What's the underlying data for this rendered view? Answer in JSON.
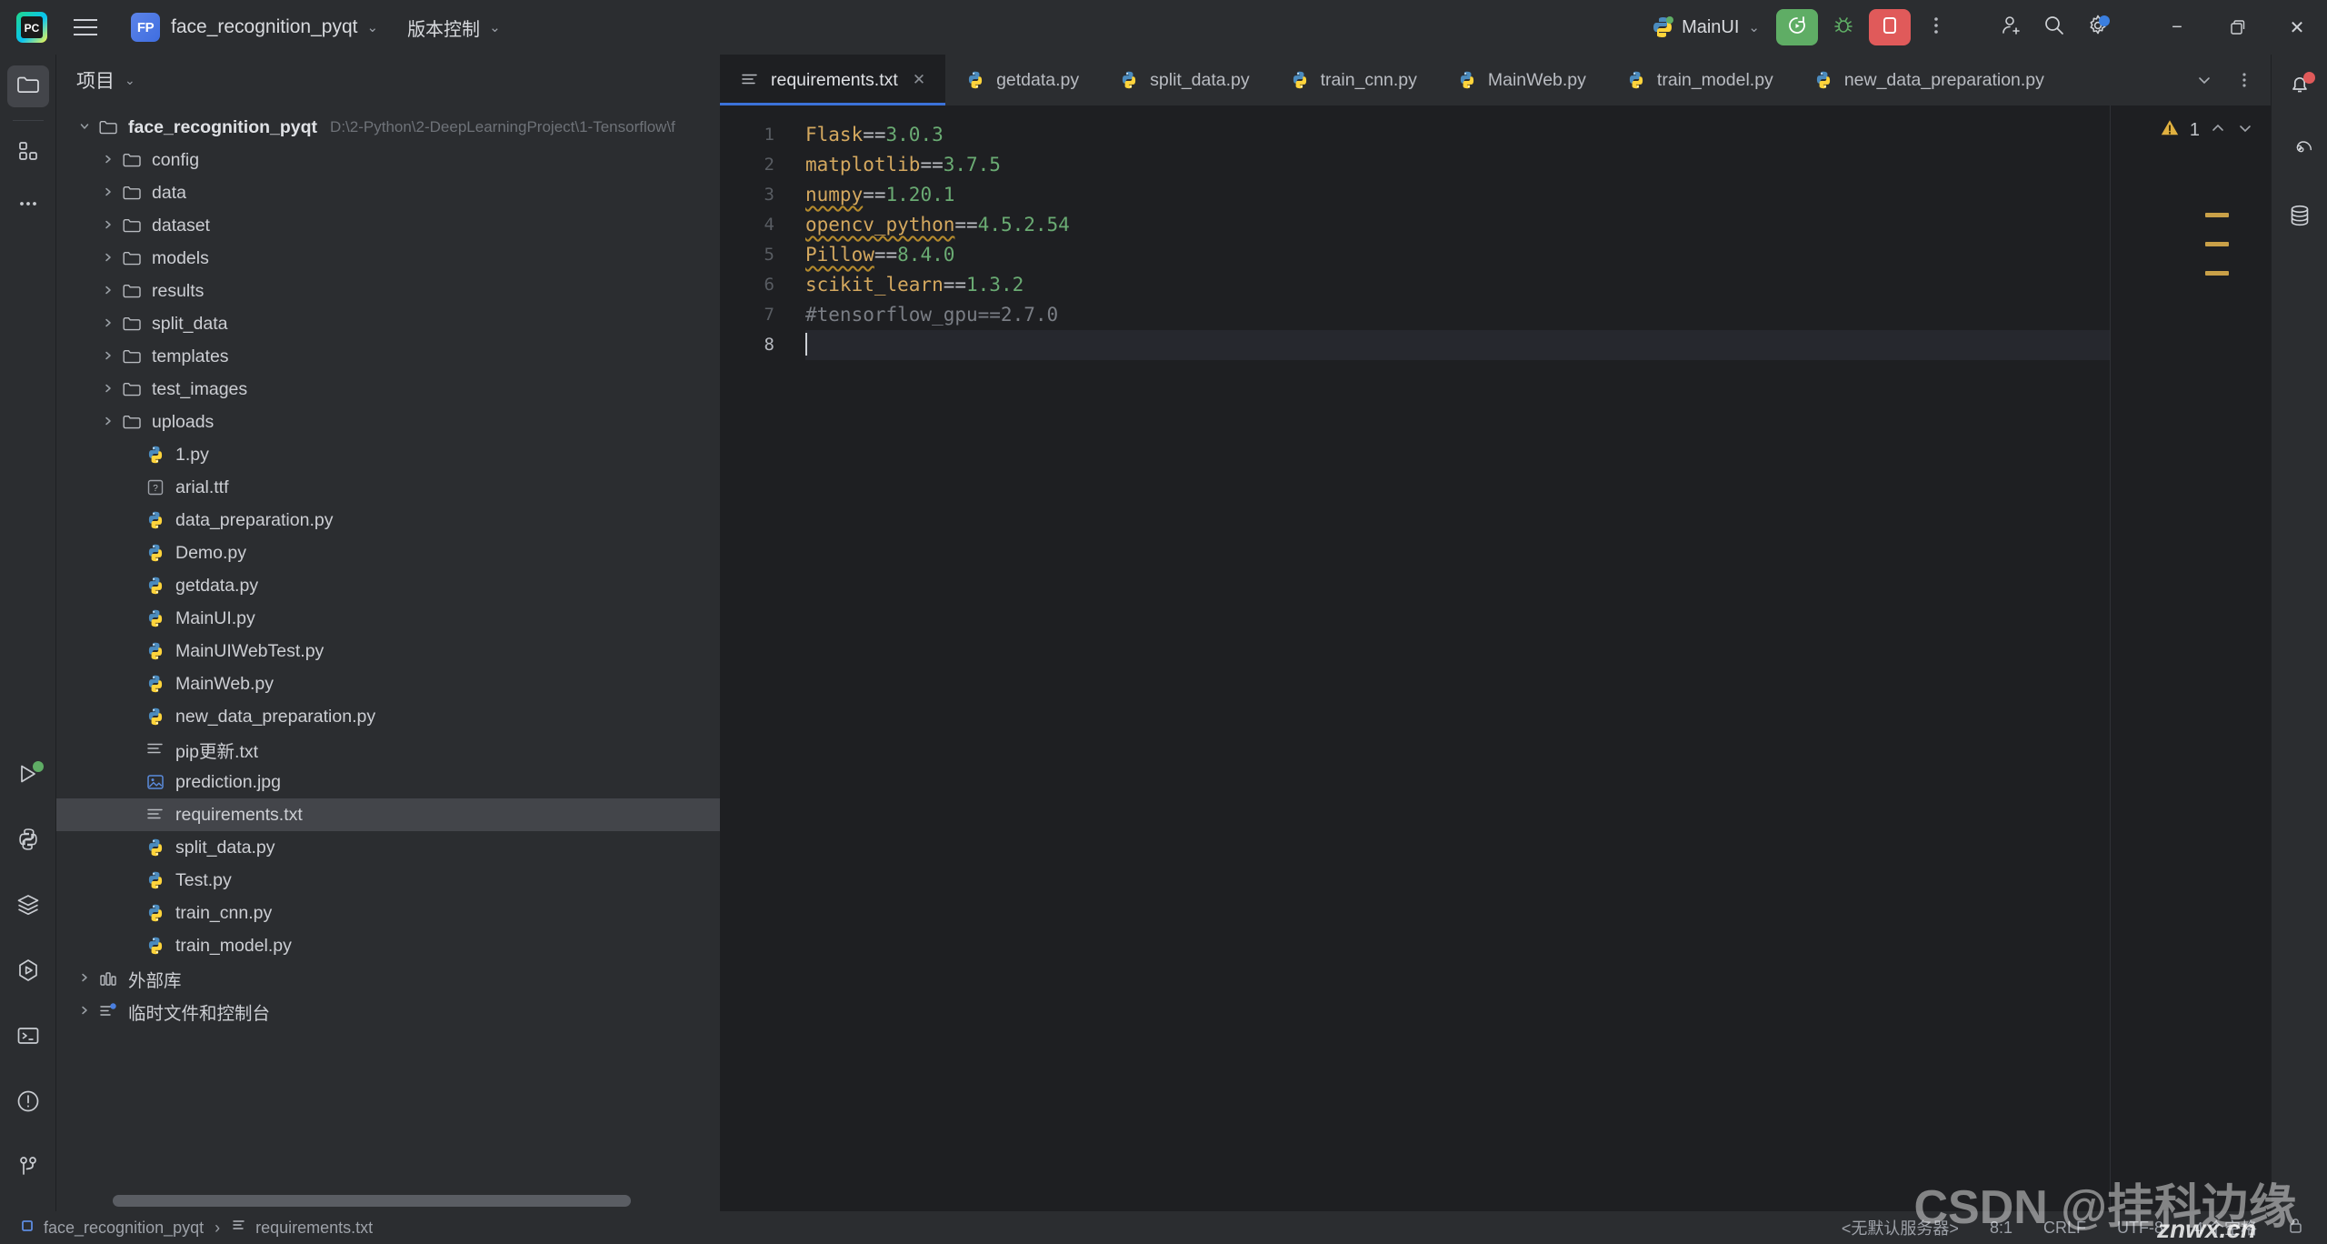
{
  "titlebar": {
    "logo_icon": "pycharm-logo-icon",
    "menu_icon": "hamburger-menu-icon",
    "project_badge": "FP",
    "project_name": "face_recognition_pyqt",
    "project_chevron": "⌄",
    "vcs_label": "版本控制",
    "vcs_chevron": "⌄",
    "run_config_name": "MainUI",
    "run_config_chevron": "⌄",
    "run_icon": "run-icon",
    "debug_icon": "debug-bug-icon",
    "stop_icon": "stop-icon",
    "more_icon": "more-vertical-icon",
    "add_user_icon": "add-user-icon",
    "search_icon": "search-icon",
    "settings_icon": "gear-icon",
    "minimize": "−",
    "maximize": "❐",
    "close": "✕",
    "accent_run": "#5fad65",
    "accent_stop": "#e05a5a",
    "accent_badge": "#4d79e0"
  },
  "left_rail": [
    {
      "name": "project-tool-window",
      "icon": "folder-icon",
      "active": true
    },
    {
      "name": "structure-tool-window",
      "icon": "grid-squares-icon",
      "active": false
    },
    {
      "name": "more-tool-windows",
      "icon": "ellipsis-icon",
      "active": false
    }
  ],
  "left_rail_bottom": [
    {
      "name": "run-tool-window",
      "icon": "play-triangle-icon",
      "dot": "#5fad65"
    },
    {
      "name": "python-packages-tool-window",
      "icon": "python-icon",
      "dot": ""
    },
    {
      "name": "python-console-tool-window",
      "icon": "layers-icon",
      "dot": ""
    },
    {
      "name": "services-tool-window",
      "icon": "hexagon-play-icon",
      "dot": ""
    },
    {
      "name": "terminal-tool-window",
      "icon": "terminal-icon",
      "dot": ""
    },
    {
      "name": "problems-tool-window",
      "icon": "warning-circle-icon",
      "dot": ""
    },
    {
      "name": "version-control-tool-window",
      "icon": "branch-icon",
      "dot": ""
    }
  ],
  "right_rail": [
    {
      "name": "notifications-tool-window",
      "icon": "bell-icon",
      "dot": "#e05a5a"
    },
    {
      "name": "ai-assistant-tool-window",
      "icon": "spiral-icon",
      "dot": ""
    },
    {
      "name": "database-tool-window",
      "icon": "database-icon",
      "dot": ""
    }
  ],
  "project_panel": {
    "title": "项目",
    "chevron": "⌄",
    "scroll_thumb_name": "horizontal-scrollbar-thumb",
    "tree": [
      {
        "indent": 0,
        "arrow": "open",
        "icon": "folder-icon",
        "label": "face_recognition_pyqt",
        "bold": true,
        "path": "D:\\2-Python\\2-DeepLearningProject\\1-Tensorflow\\f",
        "selected": false
      },
      {
        "indent": 1,
        "arrow": "closed",
        "icon": "folder-icon",
        "label": "config",
        "bold": false,
        "path": "",
        "selected": false
      },
      {
        "indent": 1,
        "arrow": "closed",
        "icon": "folder-icon",
        "label": "data",
        "bold": false,
        "path": "",
        "selected": false
      },
      {
        "indent": 1,
        "arrow": "closed",
        "icon": "folder-icon",
        "label": "dataset",
        "bold": false,
        "path": "",
        "selected": false
      },
      {
        "indent": 1,
        "arrow": "closed",
        "icon": "folder-icon",
        "label": "models",
        "bold": false,
        "path": "",
        "selected": false
      },
      {
        "indent": 1,
        "arrow": "closed",
        "icon": "folder-icon",
        "label": "results",
        "bold": false,
        "path": "",
        "selected": false
      },
      {
        "indent": 1,
        "arrow": "closed",
        "icon": "folder-icon",
        "label": "split_data",
        "bold": false,
        "path": "",
        "selected": false
      },
      {
        "indent": 1,
        "arrow": "closed",
        "icon": "folder-icon",
        "label": "templates",
        "bold": false,
        "path": "",
        "selected": false
      },
      {
        "indent": 1,
        "arrow": "closed",
        "icon": "folder-icon",
        "label": "test_images",
        "bold": false,
        "path": "",
        "selected": false
      },
      {
        "indent": 1,
        "arrow": "closed",
        "icon": "folder-icon",
        "label": "uploads",
        "bold": false,
        "path": "",
        "selected": false
      },
      {
        "indent": 2,
        "arrow": "none",
        "icon": "python-icon",
        "label": "1.py",
        "bold": false,
        "path": "",
        "selected": false
      },
      {
        "indent": 2,
        "arrow": "none",
        "icon": "unknown-file-icon",
        "label": "arial.ttf",
        "bold": false,
        "path": "",
        "selected": false
      },
      {
        "indent": 2,
        "arrow": "none",
        "icon": "python-icon",
        "label": "data_preparation.py",
        "bold": false,
        "path": "",
        "selected": false
      },
      {
        "indent": 2,
        "arrow": "none",
        "icon": "python-icon",
        "label": "Demo.py",
        "bold": false,
        "path": "",
        "selected": false
      },
      {
        "indent": 2,
        "arrow": "none",
        "icon": "python-icon",
        "label": "getdata.py",
        "bold": false,
        "path": "",
        "selected": false
      },
      {
        "indent": 2,
        "arrow": "none",
        "icon": "python-icon",
        "label": "MainUI.py",
        "bold": false,
        "path": "",
        "selected": false
      },
      {
        "indent": 2,
        "arrow": "none",
        "icon": "python-icon",
        "label": "MainUIWebTest.py",
        "bold": false,
        "path": "",
        "selected": false
      },
      {
        "indent": 2,
        "arrow": "none",
        "icon": "python-icon",
        "label": "MainWeb.py",
        "bold": false,
        "path": "",
        "selected": false
      },
      {
        "indent": 2,
        "arrow": "none",
        "icon": "python-icon",
        "label": "new_data_preparation.py",
        "bold": false,
        "path": "",
        "selected": false
      },
      {
        "indent": 2,
        "arrow": "none",
        "icon": "text-file-icon",
        "label": "pip更新.txt",
        "bold": false,
        "path": "",
        "selected": false
      },
      {
        "indent": 2,
        "arrow": "none",
        "icon": "image-file-icon",
        "label": "prediction.jpg",
        "bold": false,
        "path": "",
        "selected": false
      },
      {
        "indent": 2,
        "arrow": "none",
        "icon": "text-file-icon",
        "label": "requirements.txt",
        "bold": false,
        "path": "",
        "selected": true
      },
      {
        "indent": 2,
        "arrow": "none",
        "icon": "python-icon",
        "label": "split_data.py",
        "bold": false,
        "path": "",
        "selected": false
      },
      {
        "indent": 2,
        "arrow": "none",
        "icon": "python-icon",
        "label": "Test.py",
        "bold": false,
        "path": "",
        "selected": false
      },
      {
        "indent": 2,
        "arrow": "none",
        "icon": "python-icon",
        "label": "train_cnn.py",
        "bold": false,
        "path": "",
        "selected": false
      },
      {
        "indent": 2,
        "arrow": "none",
        "icon": "python-icon",
        "label": "train_model.py",
        "bold": false,
        "path": "",
        "selected": false
      },
      {
        "indent": 0,
        "arrow": "closed",
        "icon": "library-icon",
        "label": "外部库",
        "bold": false,
        "path": "",
        "selected": false
      },
      {
        "indent": 0,
        "arrow": "closed",
        "icon": "scratches-icon",
        "label": "临时文件和控制台",
        "bold": false,
        "path": "",
        "selected": false
      }
    ]
  },
  "editor": {
    "tabs": [
      {
        "label": "requirements.txt",
        "icon": "text-file-icon",
        "active": true,
        "closable": true
      },
      {
        "label": "getdata.py",
        "icon": "python-icon",
        "active": false,
        "closable": false
      },
      {
        "label": "split_data.py",
        "icon": "python-icon",
        "active": false,
        "closable": false
      },
      {
        "label": "train_cnn.py",
        "icon": "python-icon",
        "active": false,
        "closable": false
      },
      {
        "label": "MainWeb.py",
        "icon": "python-icon",
        "active": false,
        "closable": false
      },
      {
        "label": "train_model.py",
        "icon": "python-icon",
        "active": false,
        "closable": false
      },
      {
        "label": "new_data_preparation.py",
        "icon": "python-icon",
        "active": false,
        "closable": false
      }
    ],
    "tab_close_glyph": "✕",
    "tab_list_icon": "chevron-down-icon",
    "tab_more_icon": "more-vertical-icon",
    "gutter_lines": [
      "1",
      "2",
      "3",
      "4",
      "5",
      "6",
      "7",
      "8"
    ],
    "current_line": 8,
    "code_lines": [
      {
        "n": 1,
        "pkg": "Flask",
        "squiggle": false,
        "op": "==",
        "num": "3.0.3",
        "comment": ""
      },
      {
        "n": 2,
        "pkg": "matplotlib",
        "squiggle": false,
        "op": "==",
        "num": "3.7.5",
        "comment": ""
      },
      {
        "n": 3,
        "pkg": "numpy",
        "squiggle": true,
        "op": "==",
        "num": "1.20.1",
        "comment": ""
      },
      {
        "n": 4,
        "pkg": "opencv_python",
        "squiggle": true,
        "op": "==",
        "num": "4.5.2.54",
        "comment": ""
      },
      {
        "n": 5,
        "pkg": "Pillow",
        "squiggle": true,
        "op": "==",
        "num": "8.4.0",
        "comment": ""
      },
      {
        "n": 6,
        "pkg": "scikit_learn",
        "squiggle": false,
        "op": "==",
        "num": "1.3.2",
        "comment": ""
      },
      {
        "n": 7,
        "pkg": "",
        "squiggle": false,
        "op": "",
        "num": "",
        "comment": "#tensorflow_gpu==2.7.0"
      },
      {
        "n": 8,
        "pkg": "",
        "squiggle": false,
        "op": "",
        "num": "",
        "comment": ""
      }
    ],
    "inspection": {
      "warning_icon": "warning-triangle-icon",
      "warning_count": "1",
      "prev_icon": "chevron-up-icon",
      "next_icon": "chevron-down-icon",
      "marker_color": "#c9a048",
      "marker_count": 3
    }
  },
  "statusbar": {
    "breadcrumb_root_icon": "module-icon",
    "breadcrumb_root": "face_recognition_pyqt",
    "breadcrumb_sep": "›",
    "breadcrumb_file_icon": "text-file-icon",
    "breadcrumb_file": "requirements.txt",
    "server": "<无默认服务器>",
    "caret_pos": "8:1",
    "line_sep": "CRLF",
    "encoding": "UTF-8",
    "indent": "4 个空格",
    "lock_icon": "lock-icon"
  },
  "watermark": {
    "main": "CSDN @挂科边缘",
    "sub": "znwx.cn"
  }
}
